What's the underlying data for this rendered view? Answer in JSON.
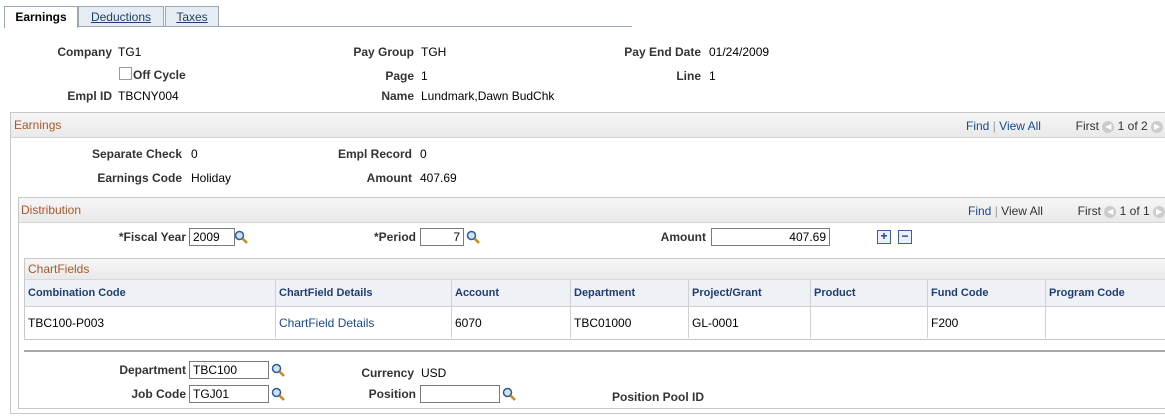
{
  "tabs": [
    {
      "label": "Earnings",
      "active": true
    },
    {
      "label": "Deductions",
      "active": false
    },
    {
      "label": "Taxes",
      "active": false
    }
  ],
  "header": {
    "company_label": "Company",
    "company": "TG1",
    "paygroup_label": "Pay Group",
    "paygroup": "TGH",
    "payend_label": "Pay End Date",
    "payend": "01/24/2009",
    "offcycle_label": "Off Cycle",
    "page_label": "Page",
    "page": "1",
    "line_label": "Line",
    "line": "1",
    "emplid_label": "Empl ID",
    "emplid": "TBCNY004",
    "name_label": "Name",
    "name": "Lundmark,Dawn BudChk"
  },
  "earnings": {
    "title": "Earnings",
    "find": "Find",
    "viewall": "View All",
    "sep": "|",
    "first": "First",
    "range": "1 of 2",
    "sepcheck_label": "Separate Check",
    "sepcheck": "0",
    "emplrec_label": "Empl Record",
    "emplrec": "0",
    "earncode_label": "Earnings Code",
    "earncode": "Holiday",
    "amount_label": "Amount",
    "amount": "407.69"
  },
  "distribution": {
    "title": "Distribution",
    "find": "Find",
    "viewall": "View All",
    "sep": "|",
    "first": "First",
    "range": "1 of 1",
    "fy_label": "*Fiscal Year",
    "fy": "2009",
    "period_label": "*Period",
    "period": "7",
    "amount_label": "Amount",
    "amount": "407.69",
    "add": "+",
    "remove": "−"
  },
  "chartfields": {
    "title": "ChartFields",
    "columns": [
      "Combination Code",
      "ChartField Details",
      "Account",
      "Department",
      "Project/Grant",
      "Product",
      "Fund Code",
      "Program Code"
    ],
    "row": [
      "TBC100-P003",
      "ChartField Details",
      "6070",
      "TBC01000",
      "GL-0001",
      "",
      "F200",
      ""
    ]
  },
  "footer": {
    "dept_label": "Department",
    "dept": "TBC100",
    "currency_label": "Currency",
    "currency": "USD",
    "jobcode_label": "Job Code",
    "jobcode": "TGJ01",
    "position_label": "Position",
    "position": "",
    "pospool_label": "Position Pool ID"
  }
}
